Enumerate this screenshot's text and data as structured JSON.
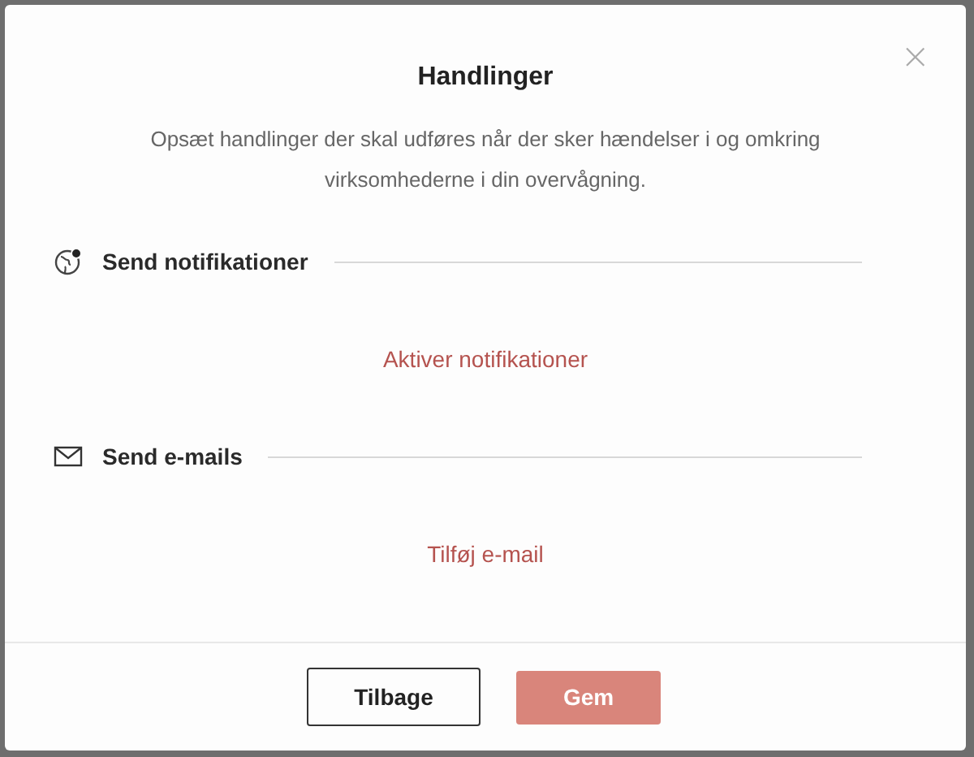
{
  "dialog": {
    "title": "Handlinger",
    "description": "Opsæt handlinger der skal udføres når der sker hændelser i og omkring virksomhederne i din overvågning.",
    "close": "×"
  },
  "sections": [
    {
      "kind": "notifications",
      "title": "Send notifikationer",
      "action": "Aktiver notifikationer"
    },
    {
      "kind": "email",
      "title": "Send e-mails",
      "action": "Tilføj e-mail"
    }
  ],
  "buttons": [
    {
      "kind": "secondary",
      "label": "Tilbage",
      "disabled": false
    },
    {
      "kind": "primary",
      "label": "Gem",
      "disabled": true
    }
  ]
}
